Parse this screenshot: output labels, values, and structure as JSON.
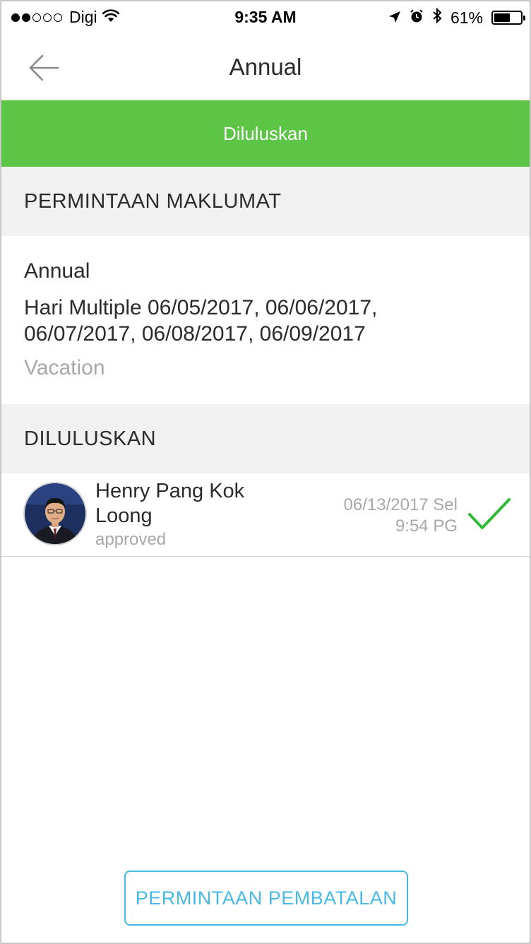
{
  "status_bar": {
    "carrier": "Digi",
    "time": "9:35 AM",
    "battery": "61%",
    "battery_level": 0.61
  },
  "nav": {
    "title": "Annual",
    "back_icon": "arrow-left-icon"
  },
  "banner": {
    "label": "Diluluskan",
    "color": "#5cc545"
  },
  "request_info": {
    "header": "PERMINTAAN MAKLUMAT",
    "leave_type": "Annual",
    "dates_line1": "Hari Multiple 06/05/2017, 06/06/2017,",
    "dates_line2": "06/07/2017, 06/08/2017, 06/09/2017",
    "reason": "Vacation"
  },
  "approvals": {
    "header": "DILULUSKAN",
    "items": [
      {
        "name_line1": "Henry Pang Kok",
        "name_line2": "Loong",
        "status": "approved",
        "date": "06/13/2017 Sel",
        "time": "9:54 PG",
        "icon": "checkmark-icon"
      }
    ]
  },
  "actions": {
    "cancel_request_label": "PERMINTAAN PEMBATALAN",
    "accent_color": "#47b9e6"
  }
}
